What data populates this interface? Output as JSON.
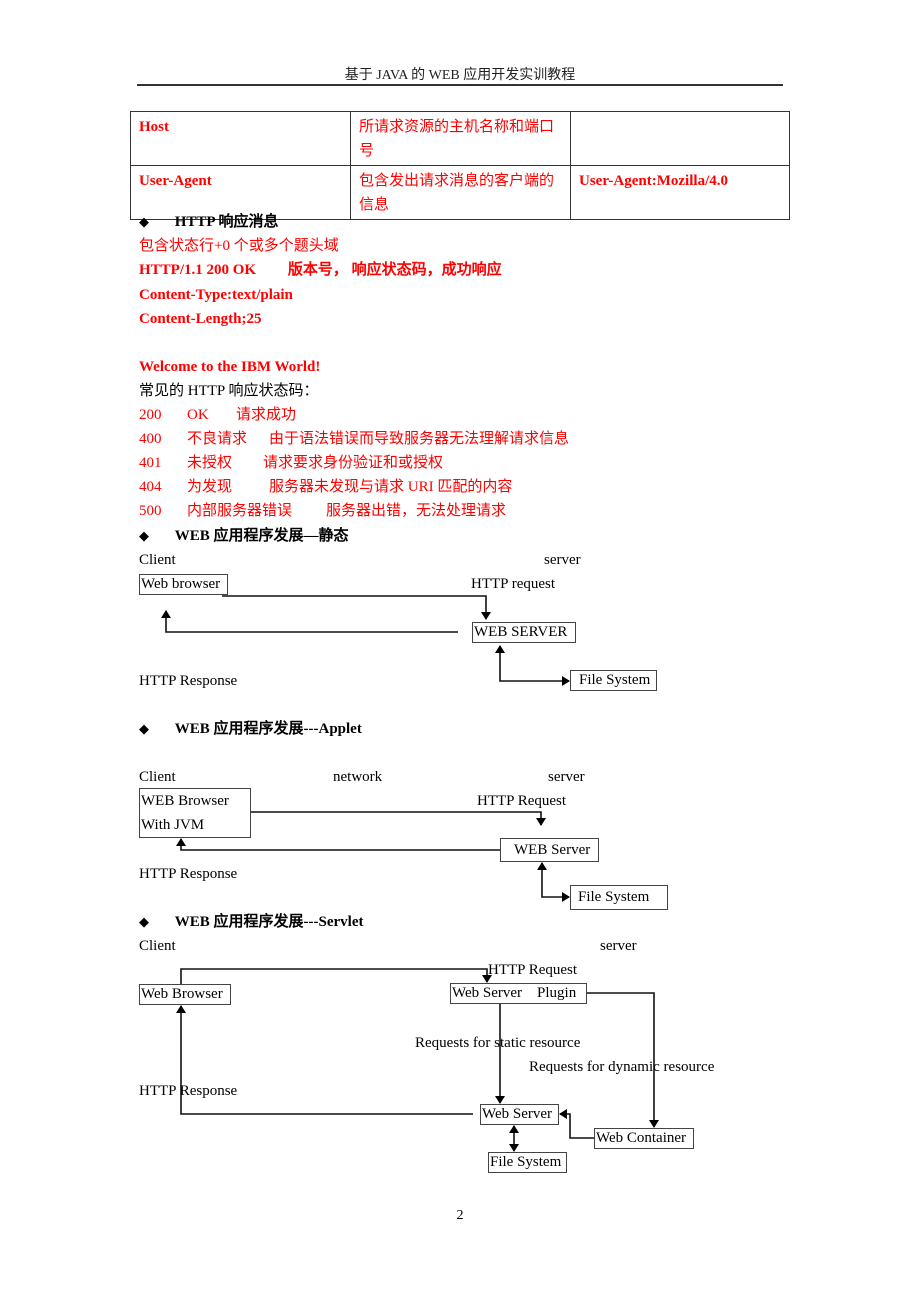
{
  "header": {
    "title": "基于 JAVA 的 WEB 应用开发实训教程"
  },
  "request_table": {
    "rows": [
      {
        "name": "Host",
        "description": "所请求资源的主机名称和端口号",
        "example": ""
      },
      {
        "name": "User-Agent",
        "description": "包含发出请求消息的客户端的信息",
        "example": "User-Agent:Mozilla/4.0"
      }
    ]
  },
  "response_section": {
    "bullet_icon": "diamond-bullet",
    "heading": "HTTP 响应消息",
    "intro": "包含状态行+0 个或多个题头域",
    "status_line": {
      "code": "HTTP/1.1 200 OK",
      "explanation": "版本号，  响应状态码，成功响应"
    },
    "content_type": "Content-Type:text/plain",
    "content_length": "Content-Length;25",
    "body": "Welcome to the IBM World!",
    "status_codes_title": "常见的 HTTP 响应状态码：",
    "status_codes": [
      {
        "code": "200",
        "name": "OK",
        "desc": "请求成功"
      },
      {
        "code": "400",
        "name": "不良请求",
        "desc": "由于语法错误而导致服务器无法理解请求信息"
      },
      {
        "code": "401",
        "name": "未授权",
        "desc": "请求要求身份验证和或授权"
      },
      {
        "code": "404",
        "name": "为发现",
        "desc": "服务器未发现与请求 URI 匹配的内容"
      },
      {
        "code": "500",
        "name": "内部服务器错误",
        "desc": "服务器出错，无法处理请求"
      }
    ]
  },
  "static_section": {
    "heading": "WEB 应用程序发展—静态",
    "client_label": "Client",
    "server_label": "server",
    "browser_box": "Web browser",
    "request_label": "HTTP request",
    "server_box": "WEB SERVER",
    "response_label": "HTTP Response",
    "fs_box": "File System"
  },
  "applet_section": {
    "heading": "WEB 应用程序发展---Applet",
    "client_label": "Client",
    "network_label": "network",
    "server_label": "server",
    "browser_box_line1": "WEB Browser",
    "browser_box_line2": "With JVM",
    "request_label": "HTTP Request",
    "server_box": "WEB Server",
    "response_label": "HTTP Response",
    "fs_box": "File System"
  },
  "servlet_section": {
    "heading": "WEB 应用程序发展---Servlet",
    "client_label": "Client",
    "server_label": "server",
    "request_label": "HTTP Request",
    "browser_box": "Web Browser",
    "plugin_box": "Web Server    Plugin",
    "static_label": "Requests for static resource",
    "dynamic_label": "Requests for dynamic resource",
    "response_label": "HTTP Response",
    "server_box": "Web Server",
    "container_box": "Web Container",
    "fs_box": "File System"
  },
  "footer": {
    "page_number": "2"
  }
}
